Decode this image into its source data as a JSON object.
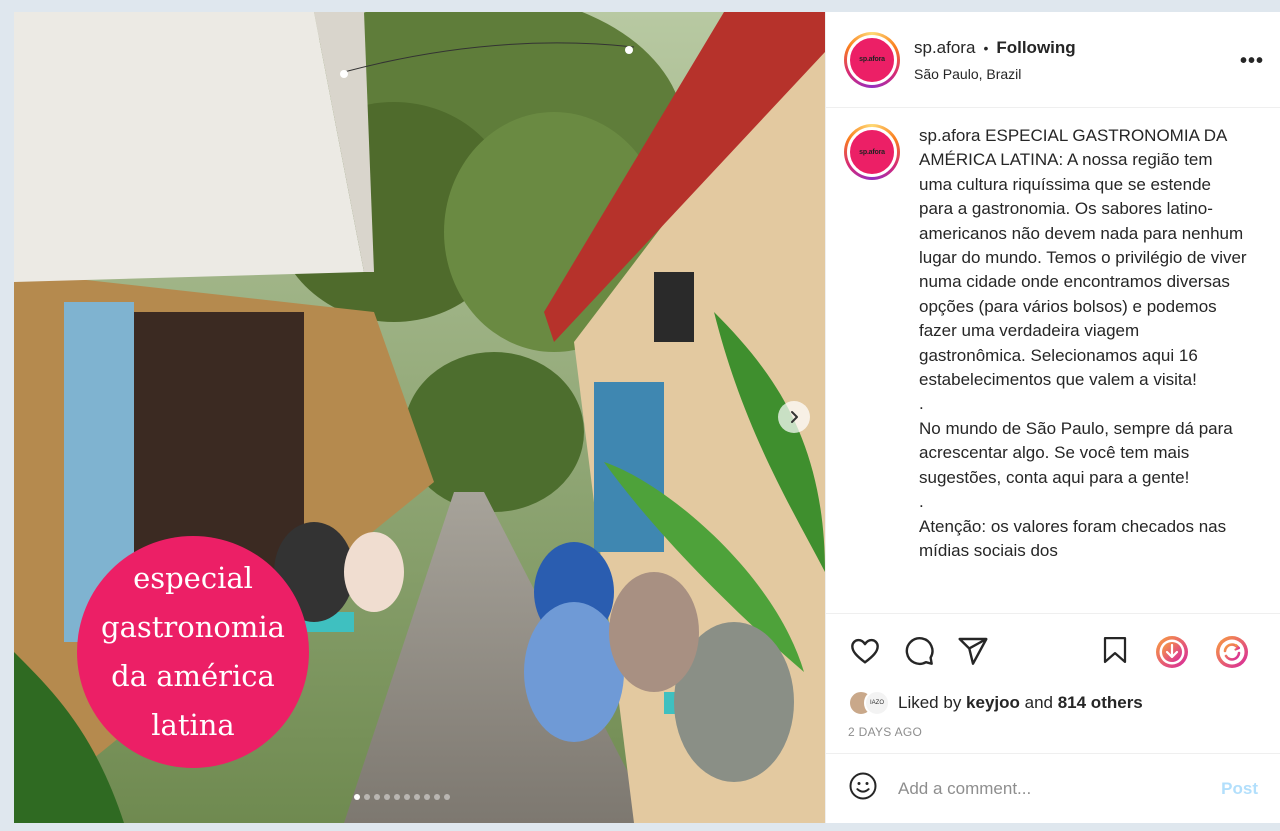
{
  "post": {
    "username": "sp.afora",
    "separator": "•",
    "follow_status": "Following",
    "location": "São Paulo, Brazil",
    "more_label": "•••",
    "avatar_logo": "sp.afora"
  },
  "media": {
    "overlay_lines": [
      "especial",
      "gastronomia",
      "da américa",
      "latina"
    ],
    "carousel_count": 10,
    "carousel_active": 1
  },
  "caption": {
    "username": "sp.afora",
    "text": " ESPECIAL GASTRONOMIA DA AMÉRICA LATINA: A nossa região tem uma cultura riquíssima que se estende para a gastronomia. Os sabores latino-americanos não devem nada para nenhum lugar do mundo. Temos o privilégio de viver numa cidade onde encontramos diversas opções (para vários bolsos) e podemos fazer uma verdadeira viagem gastronômica. Selecionamos aqui 16 estabelecimentos que valem a visita!\n.\nNo mundo de São Paulo, sempre dá para acrescentar algo. Se você tem mais sugestões, conta aqui para a gente!\n.\nAtenção: os valores foram checados nas mídias sociais dos"
  },
  "actions": {
    "icons": [
      "heart-icon",
      "comment-icon",
      "share-icon",
      "bookmark-icon"
    ]
  },
  "likes": {
    "prefix": "Liked by ",
    "user": "keyjoo",
    "middle": " and ",
    "others": "814 others",
    "avatar2_text": "IAZO"
  },
  "date": "2 DAYS AGO",
  "comment": {
    "placeholder": "Add a comment...",
    "post_label": "Post"
  },
  "colors": {
    "brand_pink": "#ec1f66",
    "post_button_disabled": "#b2dffc"
  }
}
